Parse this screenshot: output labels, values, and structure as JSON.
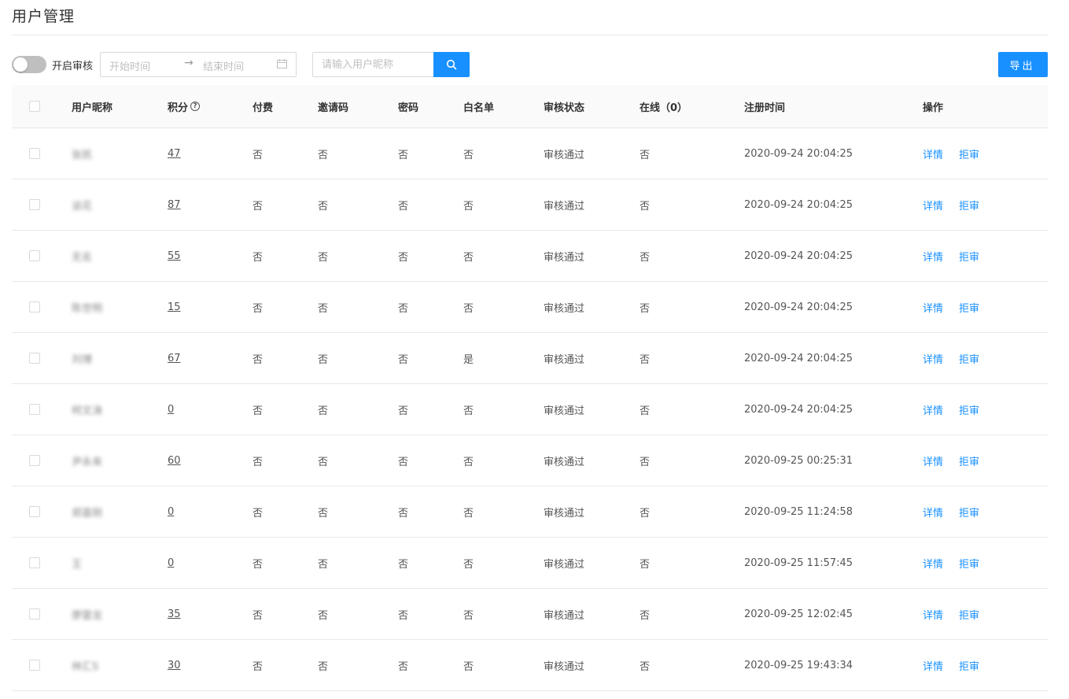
{
  "page": {
    "title": "用户管理"
  },
  "toolbar": {
    "review_switch_label": "开启审核",
    "start_placeholder": "开始时间",
    "end_placeholder": "结束时间",
    "range_arrow": "→",
    "search_placeholder": "请输入用户昵称",
    "export_label": "导出",
    "accent_color": "#1890ff"
  },
  "table": {
    "headers": {
      "name": "用户昵称",
      "points": "积分",
      "points_help": "?",
      "paid": "付费",
      "invite": "邀请码",
      "password": "密码",
      "whitelist": "白名单",
      "review": "审核状态",
      "online": "在线（0）",
      "registered": "注册时间",
      "actions": "操作"
    },
    "rows": [
      {
        "name": "张凯",
        "points": "47",
        "paid": "否",
        "invite": "否",
        "password": "否",
        "whitelist": "否",
        "review": "审核通过",
        "online": "否",
        "registered": "2020-09-24 20:04:25",
        "detail": "详情",
        "reject": "拒审"
      },
      {
        "name": "谈花",
        "points": "87",
        "paid": "否",
        "invite": "否",
        "password": "否",
        "whitelist": "否",
        "review": "审核通过",
        "online": "否",
        "registered": "2020-09-24 20:04:25",
        "detail": "详情",
        "reject": "拒审"
      },
      {
        "name": "无名",
        "points": "55",
        "paid": "否",
        "invite": "否",
        "password": "否",
        "whitelist": "否",
        "review": "审核通过",
        "online": "否",
        "registered": "2020-09-24 20:04:25",
        "detail": "详情",
        "reject": "拒审"
      },
      {
        "name": "陈世明",
        "points": "15",
        "paid": "否",
        "invite": "否",
        "password": "否",
        "whitelist": "否",
        "review": "审核通过",
        "online": "否",
        "registered": "2020-09-24 20:04:25",
        "detail": "详情",
        "reject": "拒审"
      },
      {
        "name": "刘博",
        "points": "67",
        "paid": "否",
        "invite": "否",
        "password": "否",
        "whitelist": "是",
        "review": "审核通过",
        "online": "否",
        "registered": "2020-09-24 20:04:25",
        "detail": "详情",
        "reject": "拒审"
      },
      {
        "name": "柯文涛",
        "points": "0",
        "paid": "否",
        "invite": "否",
        "password": "否",
        "whitelist": "否",
        "review": "审核通过",
        "online": "否",
        "registered": "2020-09-24 20:04:25",
        "detail": "详情",
        "reject": "拒审"
      },
      {
        "name": "尹永来",
        "points": "60",
        "paid": "否",
        "invite": "否",
        "password": "否",
        "whitelist": "否",
        "review": "审核通过",
        "online": "否",
        "registered": "2020-09-25 00:25:31",
        "detail": "详情",
        "reject": "拒审"
      },
      {
        "name": "郑喜刚",
        "points": "0",
        "paid": "否",
        "invite": "否",
        "password": "否",
        "whitelist": "否",
        "review": "审核通过",
        "online": "否",
        "registered": "2020-09-25 11:24:58",
        "detail": "详情",
        "reject": "拒审"
      },
      {
        "name": "王",
        "points": "0",
        "paid": "否",
        "invite": "否",
        "password": "否",
        "whitelist": "否",
        "review": "审核通过",
        "online": "否",
        "registered": "2020-09-25 11:57:45",
        "detail": "详情",
        "reject": "拒审"
      },
      {
        "name": "廖雷龙",
        "points": "35",
        "paid": "否",
        "invite": "否",
        "password": "否",
        "whitelist": "否",
        "review": "审核通过",
        "online": "否",
        "registered": "2020-09-25 12:02:45",
        "detail": "详情",
        "reject": "拒审"
      },
      {
        "name": "林汇S",
        "points": "30",
        "paid": "否",
        "invite": "否",
        "password": "否",
        "whitelist": "否",
        "review": "审核通过",
        "online": "否",
        "registered": "2020-09-25 19:43:34",
        "detail": "详情",
        "reject": "拒审"
      }
    ]
  }
}
